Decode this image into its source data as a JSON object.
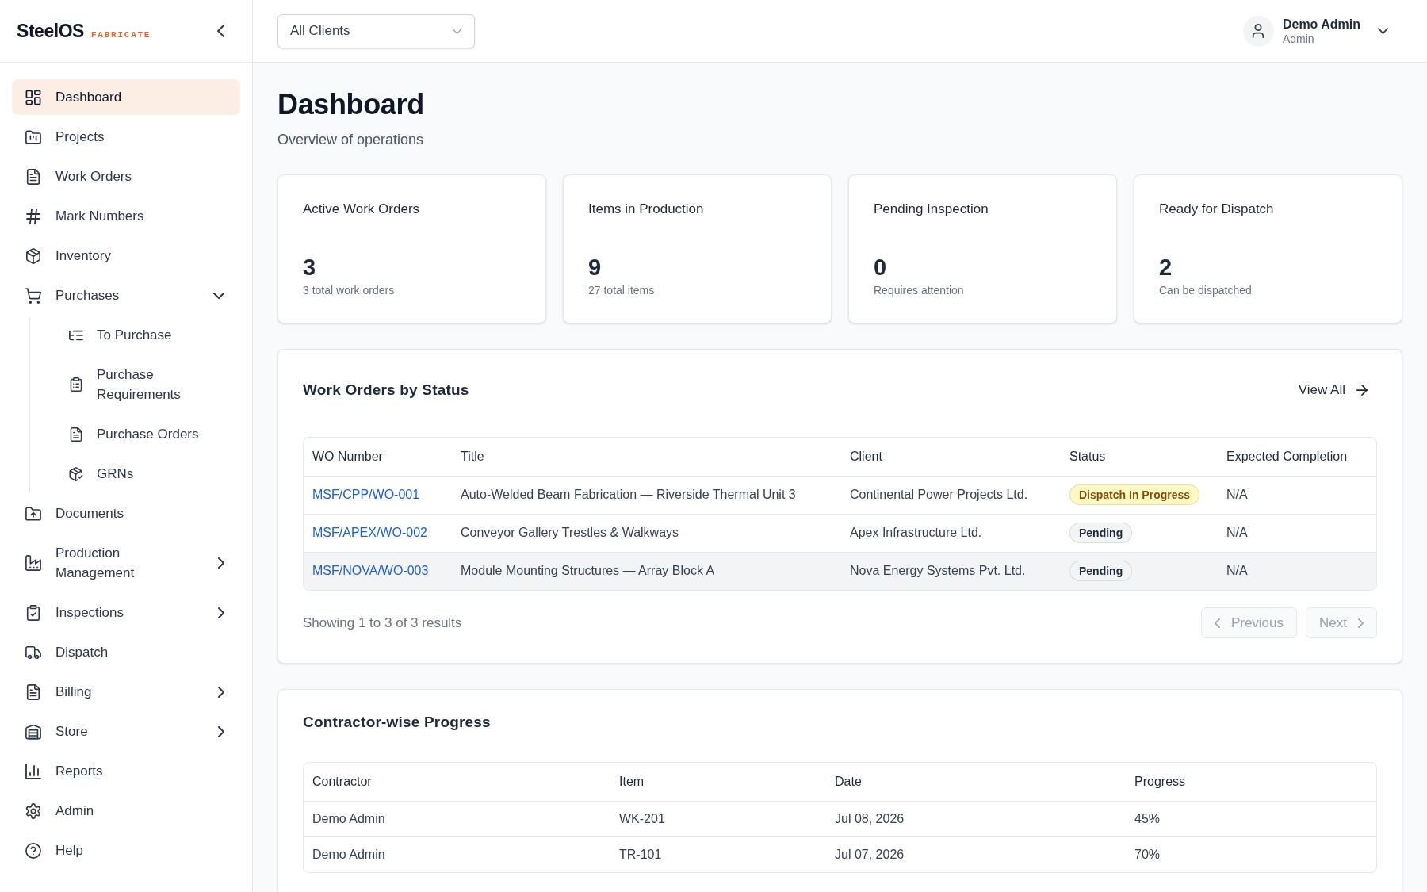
{
  "sidebar": {
    "logo": {
      "name": "SteelOS",
      "tagline": "FABRICATE"
    },
    "items": [
      {
        "label": "Dashboard",
        "kind": "link",
        "selected": true
      },
      {
        "label": "Projects",
        "kind": "link",
        "selected": false
      },
      {
        "label": "Work Orders",
        "kind": "link",
        "selected": false
      },
      {
        "label": "Mark Numbers",
        "kind": "link",
        "selected": false
      },
      {
        "label": "Inventory",
        "kind": "link",
        "selected": false
      },
      {
        "label": "Purchases",
        "kind": "group",
        "selected": false,
        "expanded": true,
        "children": [
          {
            "label": "To Purchase",
            "selected": false
          },
          {
            "label": "Purchase Requirements",
            "selected": false
          },
          {
            "label": "Purchase Orders",
            "selected": false
          },
          {
            "label": "GRNs",
            "selected": false
          }
        ]
      },
      {
        "label": "Documents",
        "kind": "link",
        "selected": false
      },
      {
        "label": "Production Management",
        "kind": "group",
        "selected": false,
        "expanded": false
      },
      {
        "label": "Inspections",
        "kind": "group",
        "selected": false,
        "expanded": false
      },
      {
        "label": "Dispatch",
        "kind": "link",
        "selected": false
      },
      {
        "label": "Billing",
        "kind": "group",
        "selected": false,
        "expanded": false
      },
      {
        "label": "Store",
        "kind": "group",
        "selected": false,
        "expanded": false
      },
      {
        "label": "Reports",
        "kind": "link",
        "selected": false
      },
      {
        "label": "Admin",
        "kind": "link",
        "selected": false
      },
      {
        "label": "Help",
        "kind": "link",
        "selected": false
      }
    ]
  },
  "top_bar": {
    "client_filter": {
      "value": "All Clients"
    },
    "user": {
      "name": "Demo Admin",
      "role": "Admin"
    }
  },
  "page": {
    "title": "Dashboard",
    "subtitle": "Overview of operations"
  },
  "stats": [
    {
      "label": "Active Work Orders",
      "value": "3",
      "caption": "3 total work orders"
    },
    {
      "label": "Items in Production",
      "value": "9",
      "caption": "27 total items"
    },
    {
      "label": "Pending Inspection",
      "value": "0",
      "caption": "Requires attention"
    },
    {
      "label": "Ready for Dispatch",
      "value": "2",
      "caption": "Can be dispatched"
    }
  ],
  "work_orders": {
    "title": "Work Orders by Status",
    "view_all": "View All",
    "columns": [
      "WO Number",
      "Title",
      "Client",
      "Status",
      "Expected Completion"
    ],
    "rows": [
      {
        "wo_number": "MSF/CPP/WO-001",
        "title": "Auto-Welded Beam Fabrication — Riverside Thermal Unit 3",
        "client": "Continental Power Projects Ltd.",
        "status": "Dispatch In Progress",
        "color": "#fef9c3",
        "expected_completion": "N/A",
        "highlighted": false
      },
      {
        "wo_number": "MSF/APEX/WO-002",
        "title": "Conveyor Gallery Trestles & Walkways",
        "client": "Apex Infrastructure Ltd.",
        "status": "Pending",
        "color": "#f3f4f6",
        "expected_completion": "N/A",
        "highlighted": false
      },
      {
        "wo_number": "MSF/NOVA/WO-003",
        "title": "Module Mounting Structures — Array Block A",
        "client": "Nova Energy Systems Pvt. Ltd.",
        "status": "Pending",
        "color": "#f3f4f6",
        "expected_completion": "N/A",
        "highlighted": true
      }
    ],
    "summary": "Showing 1 to 3 of 3 results",
    "pagination": [
      {
        "label": "Previous",
        "disabled": true
      },
      {
        "label": "Next",
        "disabled": true
      }
    ]
  },
  "contractor_progress": {
    "title": "Contractor-wise Progress",
    "columns": [
      "Contractor",
      "Item",
      "Date",
      "Progress"
    ],
    "rows": [
      {
        "contractor": "Demo Admin",
        "item": "WK-201",
        "date": "Jul 08, 2026",
        "progress": "45%"
      },
      {
        "contractor": "Demo Admin",
        "item": "TR-101",
        "date": "Jul 07, 2026",
        "progress": "70%"
      }
    ]
  }
}
